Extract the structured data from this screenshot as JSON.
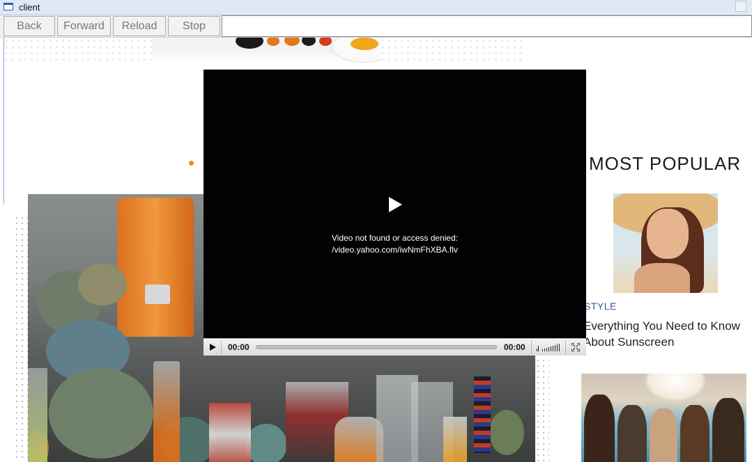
{
  "window": {
    "title": "client"
  },
  "toolbar": {
    "buttons": [
      {
        "label": "Back"
      },
      {
        "label": "Forward"
      },
      {
        "label": "Reload"
      },
      {
        "label": "Stop"
      }
    ],
    "address_value": ""
  },
  "video_player": {
    "error_line1": "Video not found or access denied:",
    "error_line2": "/video.yahoo.com/iwNmFhXBA.flv",
    "current_time": "00:00",
    "duration": "00:00",
    "progress": 0
  },
  "sidebar": {
    "heading": "MOST POPULAR",
    "article": {
      "category": "STYLE",
      "headline": "Everything You Need to Know About Sunscreen"
    }
  },
  "colors": {
    "accent_orange": "#f08a1b",
    "category_blue": "#3b56a6"
  },
  "icons": [
    "window-icon",
    "play-icon",
    "volume-icon",
    "fullscreen-icon"
  ]
}
